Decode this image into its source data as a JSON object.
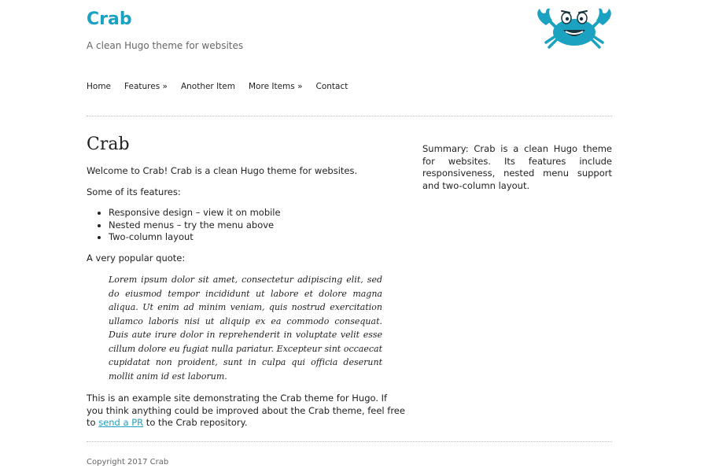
{
  "header": {
    "title": "Crab",
    "tagline": "A clean Hugo theme for websites",
    "logo_icon": "crab-icon",
    "accent_color": "#1aa2c0"
  },
  "nav": {
    "items": [
      {
        "label": "Home"
      },
      {
        "label": "Features »"
      },
      {
        "label": "Another Item"
      },
      {
        "label": "More Items »"
      },
      {
        "label": "Contact"
      }
    ]
  },
  "main": {
    "heading": "Crab",
    "intro": "Welcome to Crab! Crab is a clean Hugo theme for websites.",
    "features_intro": "Some of its features:",
    "features": [
      "Responsive design – view it on mobile",
      "Nested menus – try the menu above",
      "Two-column layout"
    ],
    "quote_intro": "A very popular quote:",
    "quote": "Lorem ipsum dolor sit amet, consectetur adipiscing elit, sed do eiusmod tempor incididunt ut labore et dolore magna aliqua. Ut enim ad minim veniam, quis nostrud exercitation ullamco laboris nisi ut aliquip ex ea commodo consequat. Duis aute irure dolor in reprehenderit in voluptate velit esse cillum dolore eu fugiat nulla pariatur. Excepteur sint occaecat cupidatat non proident, sunt in culpa qui officia deserunt mollit anim id est laborum.",
    "outro_before": "This is an example site demonstrating the Crab theme for Hugo. If you think anything could be improved about the Crab theme, feel free to ",
    "outro_link": "send a PR",
    "outro_after": " to the Crab repository."
  },
  "sidebar": {
    "summary": "Summary: Crab is a clean Hugo theme for websites. Its features include responsiveness, nested menu support and two-column layout."
  },
  "footer": {
    "copyright": "Copyright 2017 Crab"
  }
}
